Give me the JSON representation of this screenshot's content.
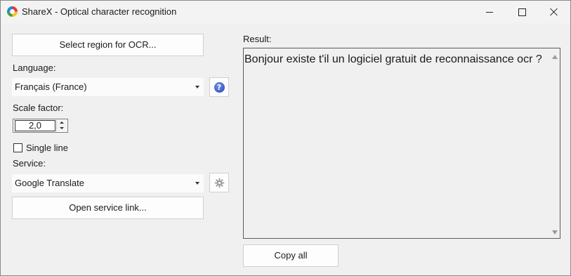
{
  "window": {
    "title": "ShareX - Optical character recognition",
    "icon": "sharex-logo-icon"
  },
  "left": {
    "select_region_label": "Select region for OCR...",
    "language_label": "Language:",
    "language_value": "Français (France)",
    "scale_factor_label": "Scale factor:",
    "scale_factor_value": "2,0",
    "single_line_label": "Single line",
    "single_line_checked": false,
    "service_label": "Service:",
    "service_value": "Google Translate",
    "open_service_link_label": "Open service link..."
  },
  "right": {
    "result_label": "Result:",
    "result_text": "Bonjour existe t'il un logiciel gratuit de reconnaissance ocr ?",
    "copy_all_label": "Copy all"
  },
  "colors": {
    "window_bg": "#f0f0f0",
    "help_icon": "#2346b8"
  }
}
